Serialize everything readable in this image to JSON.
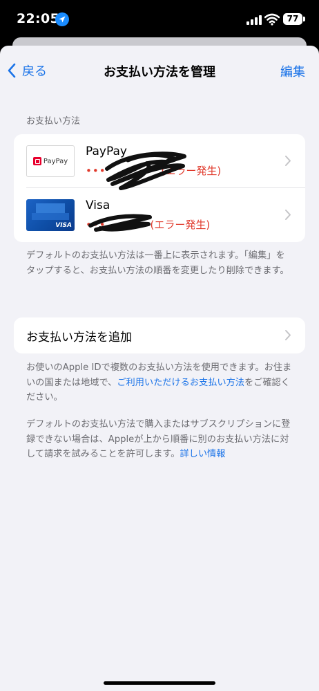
{
  "status_bar": {
    "time": "22:05",
    "battery": "77"
  },
  "nav": {
    "back_label": "戻る",
    "title": "お支払い方法を管理",
    "edit_label": "編集"
  },
  "payment_section": {
    "header": "お支払い方法",
    "methods": [
      {
        "name": "PayPay",
        "logo_text": "PayPay",
        "status_dots": "•••",
        "status": "(エラー発生)"
      },
      {
        "name": "Visa",
        "logo_text": "VISA",
        "status_dots": "•••",
        "status": "(エラー発生)"
      }
    ],
    "footer": "デフォルトのお支払い方法は一番上に表示されます。「編集」をタップすると、お支払い方法の順番を変更したり削除できます。"
  },
  "add_payment": {
    "label": "お支払い方法を追加"
  },
  "info1": {
    "text_before": "お使いのApple IDで複数のお支払い方法を使用できます。お住まいの国または地域で、",
    "link": "ご利用いただけるお支払い方法",
    "text_after": "をご確認ください。"
  },
  "info2": {
    "text": "デフォルトのお支払い方法で購入またはサブスクリプションに登録できない場合は、Appleが上から順番に別のお支払い方法に対して請求を試みることを許可します。",
    "link": "詳しい情報"
  },
  "colors": {
    "accent": "#1a73e8",
    "error": "#e0392b",
    "background": "#f2f2f7"
  }
}
